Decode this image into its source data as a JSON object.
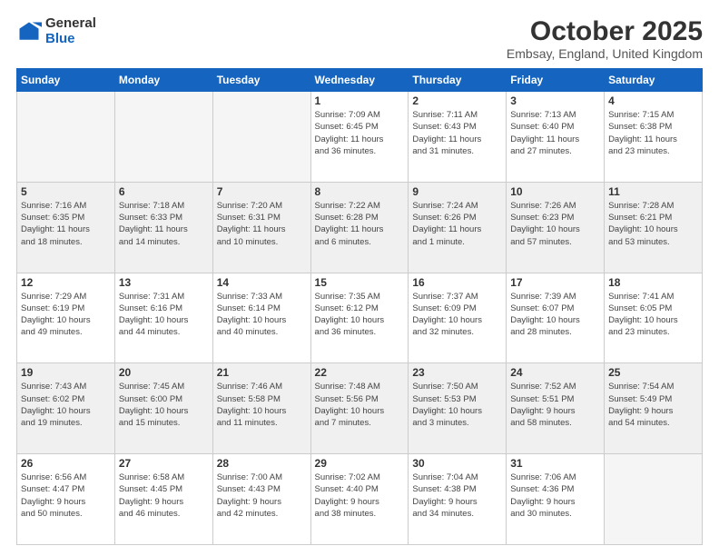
{
  "header": {
    "logo_general": "General",
    "logo_blue": "Blue",
    "month_title": "October 2025",
    "subtitle": "Embsay, England, United Kingdom"
  },
  "weekdays": [
    "Sunday",
    "Monday",
    "Tuesday",
    "Wednesday",
    "Thursday",
    "Friday",
    "Saturday"
  ],
  "weeks": [
    [
      {
        "day": "",
        "info": ""
      },
      {
        "day": "",
        "info": ""
      },
      {
        "day": "",
        "info": ""
      },
      {
        "day": "1",
        "info": "Sunrise: 7:09 AM\nSunset: 6:45 PM\nDaylight: 11 hours\nand 36 minutes."
      },
      {
        "day": "2",
        "info": "Sunrise: 7:11 AM\nSunset: 6:43 PM\nDaylight: 11 hours\nand 31 minutes."
      },
      {
        "day": "3",
        "info": "Sunrise: 7:13 AM\nSunset: 6:40 PM\nDaylight: 11 hours\nand 27 minutes."
      },
      {
        "day": "4",
        "info": "Sunrise: 7:15 AM\nSunset: 6:38 PM\nDaylight: 11 hours\nand 23 minutes."
      }
    ],
    [
      {
        "day": "5",
        "info": "Sunrise: 7:16 AM\nSunset: 6:35 PM\nDaylight: 11 hours\nand 18 minutes."
      },
      {
        "day": "6",
        "info": "Sunrise: 7:18 AM\nSunset: 6:33 PM\nDaylight: 11 hours\nand 14 minutes."
      },
      {
        "day": "7",
        "info": "Sunrise: 7:20 AM\nSunset: 6:31 PM\nDaylight: 11 hours\nand 10 minutes."
      },
      {
        "day": "8",
        "info": "Sunrise: 7:22 AM\nSunset: 6:28 PM\nDaylight: 11 hours\nand 6 minutes."
      },
      {
        "day": "9",
        "info": "Sunrise: 7:24 AM\nSunset: 6:26 PM\nDaylight: 11 hours\nand 1 minute."
      },
      {
        "day": "10",
        "info": "Sunrise: 7:26 AM\nSunset: 6:23 PM\nDaylight: 10 hours\nand 57 minutes."
      },
      {
        "day": "11",
        "info": "Sunrise: 7:28 AM\nSunset: 6:21 PM\nDaylight: 10 hours\nand 53 minutes."
      }
    ],
    [
      {
        "day": "12",
        "info": "Sunrise: 7:29 AM\nSunset: 6:19 PM\nDaylight: 10 hours\nand 49 minutes."
      },
      {
        "day": "13",
        "info": "Sunrise: 7:31 AM\nSunset: 6:16 PM\nDaylight: 10 hours\nand 44 minutes."
      },
      {
        "day": "14",
        "info": "Sunrise: 7:33 AM\nSunset: 6:14 PM\nDaylight: 10 hours\nand 40 minutes."
      },
      {
        "day": "15",
        "info": "Sunrise: 7:35 AM\nSunset: 6:12 PM\nDaylight: 10 hours\nand 36 minutes."
      },
      {
        "day": "16",
        "info": "Sunrise: 7:37 AM\nSunset: 6:09 PM\nDaylight: 10 hours\nand 32 minutes."
      },
      {
        "day": "17",
        "info": "Sunrise: 7:39 AM\nSunset: 6:07 PM\nDaylight: 10 hours\nand 28 minutes."
      },
      {
        "day": "18",
        "info": "Sunrise: 7:41 AM\nSunset: 6:05 PM\nDaylight: 10 hours\nand 23 minutes."
      }
    ],
    [
      {
        "day": "19",
        "info": "Sunrise: 7:43 AM\nSunset: 6:02 PM\nDaylight: 10 hours\nand 19 minutes."
      },
      {
        "day": "20",
        "info": "Sunrise: 7:45 AM\nSunset: 6:00 PM\nDaylight: 10 hours\nand 15 minutes."
      },
      {
        "day": "21",
        "info": "Sunrise: 7:46 AM\nSunset: 5:58 PM\nDaylight: 10 hours\nand 11 minutes."
      },
      {
        "day": "22",
        "info": "Sunrise: 7:48 AM\nSunset: 5:56 PM\nDaylight: 10 hours\nand 7 minutes."
      },
      {
        "day": "23",
        "info": "Sunrise: 7:50 AM\nSunset: 5:53 PM\nDaylight: 10 hours\nand 3 minutes."
      },
      {
        "day": "24",
        "info": "Sunrise: 7:52 AM\nSunset: 5:51 PM\nDaylight: 9 hours\nand 58 minutes."
      },
      {
        "day": "25",
        "info": "Sunrise: 7:54 AM\nSunset: 5:49 PM\nDaylight: 9 hours\nand 54 minutes."
      }
    ],
    [
      {
        "day": "26",
        "info": "Sunrise: 6:56 AM\nSunset: 4:47 PM\nDaylight: 9 hours\nand 50 minutes."
      },
      {
        "day": "27",
        "info": "Sunrise: 6:58 AM\nSunset: 4:45 PM\nDaylight: 9 hours\nand 46 minutes."
      },
      {
        "day": "28",
        "info": "Sunrise: 7:00 AM\nSunset: 4:43 PM\nDaylight: 9 hours\nand 42 minutes."
      },
      {
        "day": "29",
        "info": "Sunrise: 7:02 AM\nSunset: 4:40 PM\nDaylight: 9 hours\nand 38 minutes."
      },
      {
        "day": "30",
        "info": "Sunrise: 7:04 AM\nSunset: 4:38 PM\nDaylight: 9 hours\nand 34 minutes."
      },
      {
        "day": "31",
        "info": "Sunrise: 7:06 AM\nSunset: 4:36 PM\nDaylight: 9 hours\nand 30 minutes."
      },
      {
        "day": "",
        "info": ""
      }
    ]
  ]
}
